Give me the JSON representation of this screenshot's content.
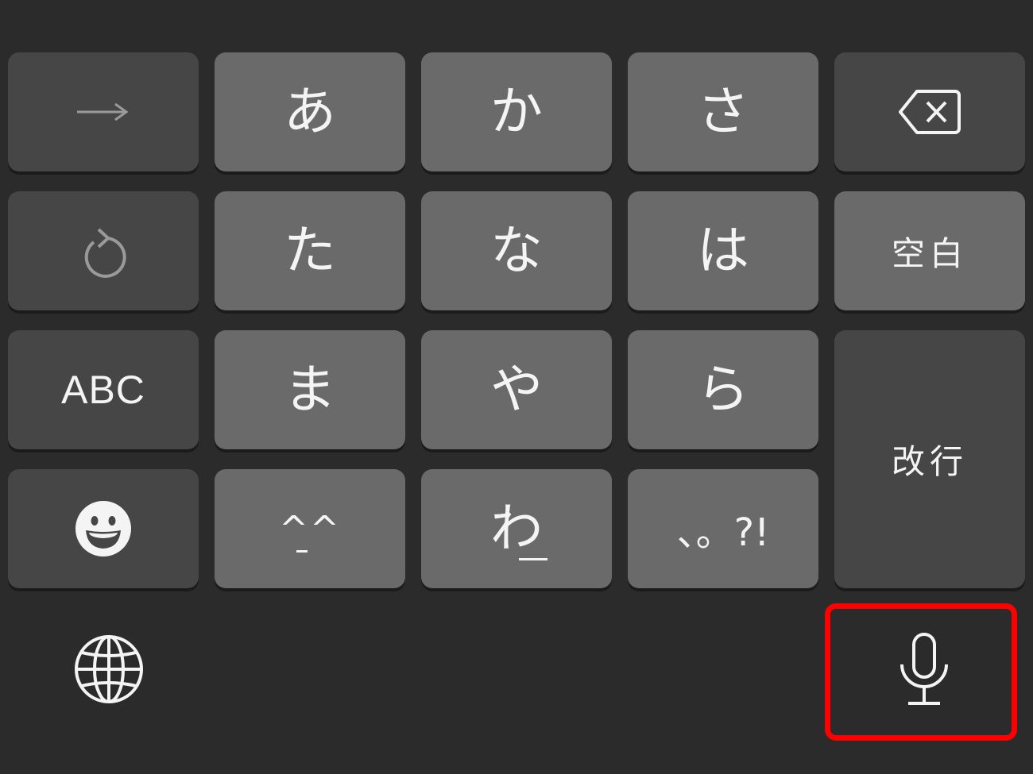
{
  "keyboard": {
    "rows": [
      {
        "left_key": {
          "icon": "arrow-right-icon"
        },
        "keys": [
          "あ",
          "か",
          "さ"
        ],
        "right_key": {
          "icon": "backspace-icon"
        }
      },
      {
        "left_key": {
          "icon": "undo-icon"
        },
        "keys": [
          "た",
          "な",
          "は"
        ],
        "right_key": {
          "label": "空白"
        }
      },
      {
        "left_key": {
          "label": "ABC"
        },
        "keys": [
          "ま",
          "や",
          "ら"
        ],
        "right_key": {
          "label": "改行"
        }
      },
      {
        "left_key": {
          "icon": "emoji-icon"
        },
        "keys": [
          "^^",
          "わ",
          "、。?!"
        ]
      }
    ],
    "bottom_bar": {
      "globe_icon": "globe-icon",
      "mic_icon": "microphone-icon"
    },
    "colors": {
      "background": "#2b2b2b",
      "light_key": "#6a6a6a",
      "dark_key": "#464646",
      "highlight": "#ff0000"
    }
  }
}
